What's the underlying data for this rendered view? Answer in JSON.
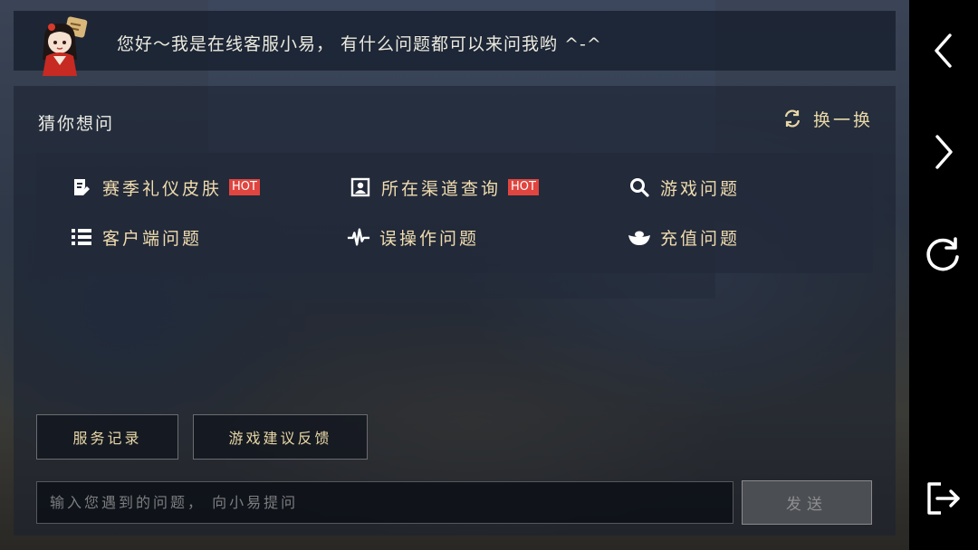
{
  "banner": {
    "greeting": "您好～我是在线客服小易， 有什么问题都可以来问我哟 ^-^"
  },
  "panel": {
    "title": "猜你想问",
    "refresh_label": "换一换"
  },
  "questions": [
    {
      "label": "赛季礼仪皮肤",
      "hot": "HOT",
      "icon": "edit-document-icon"
    },
    {
      "label": "所在渠道查询",
      "hot": "HOT",
      "icon": "portrait-frame-icon"
    },
    {
      "label": "游戏问题",
      "hot": "",
      "icon": "search-icon"
    },
    {
      "label": "客户端问题",
      "hot": "",
      "icon": "list-icon"
    },
    {
      "label": "误操作问题",
      "hot": "",
      "icon": "waveform-icon"
    },
    {
      "label": "充值问题",
      "hot": "",
      "icon": "gold-ingot-icon"
    }
  ],
  "actions": {
    "service_record": "服务记录",
    "feedback": "游戏建议反馈"
  },
  "chat": {
    "placeholder": "输入您遇到的问题， 向小易提问",
    "send_label": "发送"
  },
  "colors": {
    "accent": "#f0dcae",
    "hot_badge": "#e0453f"
  },
  "nav": [
    "chevron-left-icon",
    "chevron-right-icon",
    "refresh-icon",
    "exit-icon"
  ]
}
